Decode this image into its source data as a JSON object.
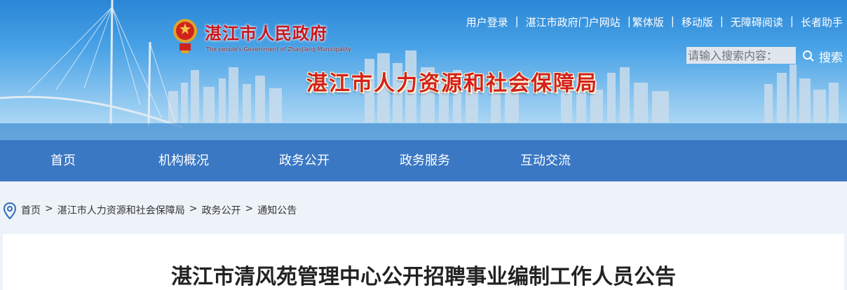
{
  "header": {
    "gov_name": "湛江市人民政府",
    "gov_name_en": "The people's Government of Zhanjiang Municipality",
    "bureau_name": "湛江市人力资源和社会保障局",
    "colors": {
      "sky": "#2a86d6",
      "bureau_text": "#d3211d"
    }
  },
  "top_links": [
    {
      "label": "用户登录"
    },
    {
      "label": "湛江市政府门户网站"
    },
    {
      "label": "繁体版"
    },
    {
      "label": "移动版"
    },
    {
      "label": "无障碍阅读"
    },
    {
      "label": "长者助手"
    }
  ],
  "search": {
    "placeholder": "请输入搜索内容：",
    "button_label": "搜索",
    "icon": "search-icon"
  },
  "nav": [
    {
      "label": "首页"
    },
    {
      "label": "机构概况"
    },
    {
      "label": "政务公开"
    },
    {
      "label": "政务服务"
    },
    {
      "label": "互动交流"
    }
  ],
  "breadcrumb": {
    "icon": "location-pin-icon",
    "items": [
      {
        "label": "首页"
      },
      {
        "label": "湛江市人力资源和社会保障局"
      },
      {
        "label": "政务公开"
      },
      {
        "label": "通知公告"
      }
    ],
    "separator": ">"
  },
  "article": {
    "title": "湛江市清风苑管理中心公开招聘事业编制工作人员公告"
  }
}
